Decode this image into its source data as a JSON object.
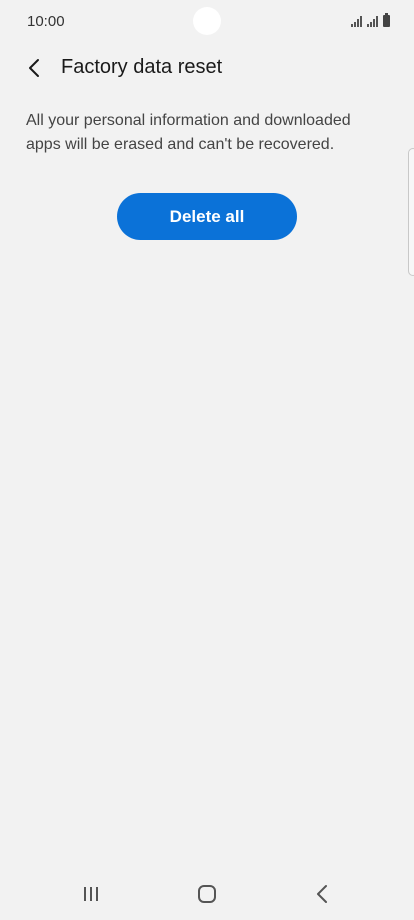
{
  "status_bar": {
    "time": "10:00"
  },
  "header": {
    "title": "Factory data reset",
    "back_icon": "chevron-left-icon"
  },
  "main": {
    "description": "All your personal information and downloaded apps will be erased and can't be recovered.",
    "delete_button_label": "Delete all"
  },
  "colors": {
    "background": "#f2f2f2",
    "accent": "#0b72d8",
    "text": "#1a1a1a"
  },
  "nav_bar": {
    "icons": [
      "recents-icon",
      "home-icon",
      "back-icon"
    ]
  }
}
